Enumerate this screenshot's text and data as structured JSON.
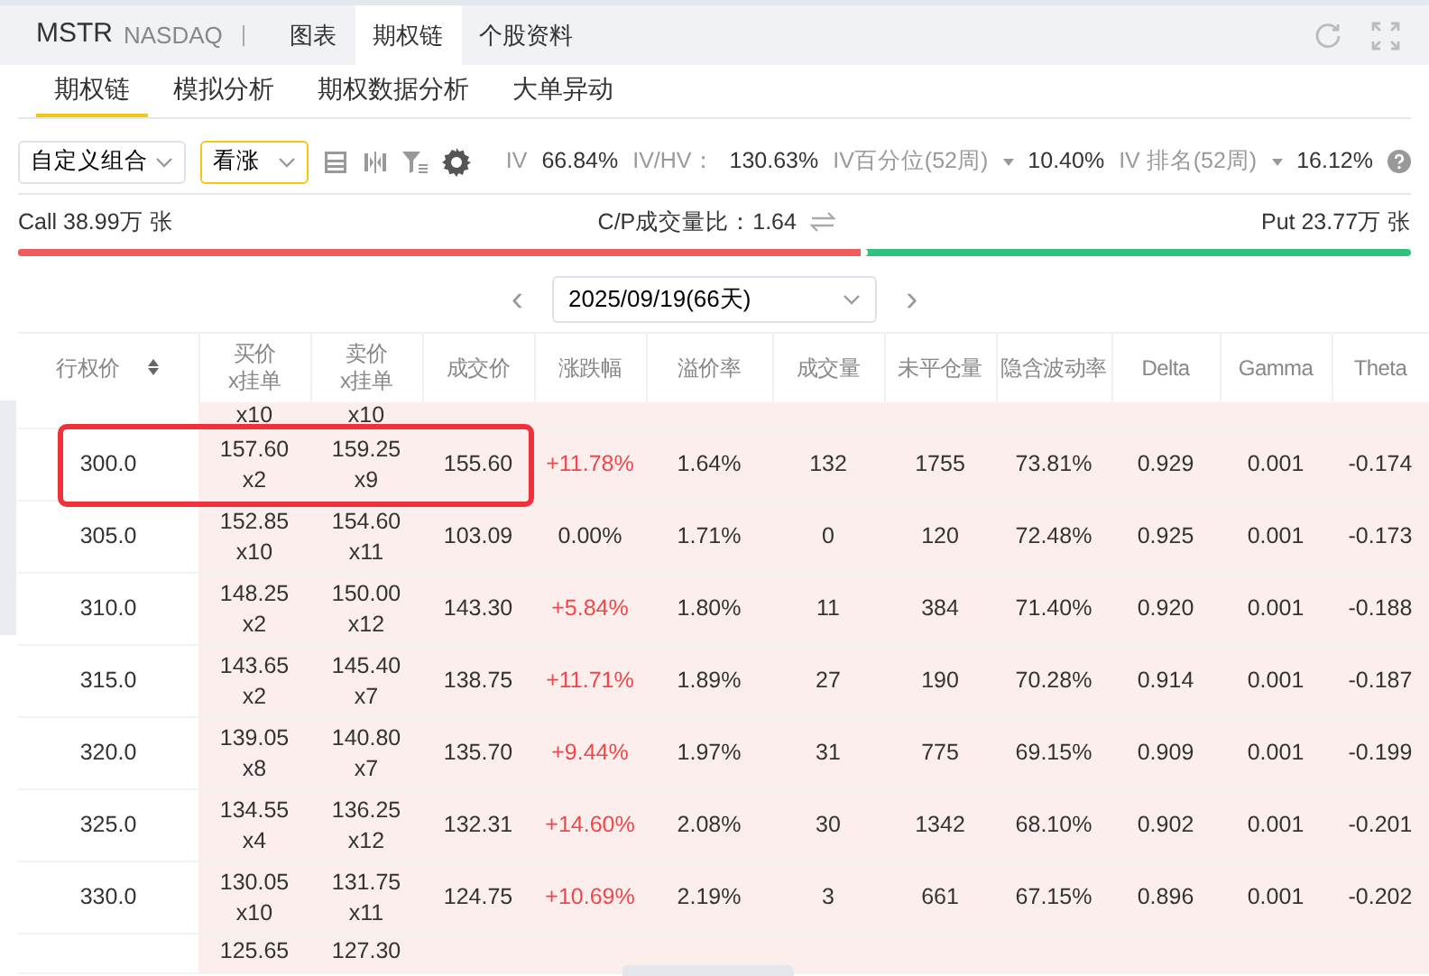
{
  "header": {
    "symbol": "MSTR",
    "exchange": "NASDAQ",
    "separator": "|",
    "tabs": [
      {
        "label": "图表",
        "selected": false
      },
      {
        "label": "期权链",
        "selected": true
      },
      {
        "label": "个股资料",
        "selected": false
      }
    ]
  },
  "subtabs": [
    {
      "label": "期权链",
      "selected": true
    },
    {
      "label": "模拟分析",
      "selected": false
    },
    {
      "label": "期权数据分析",
      "selected": false
    },
    {
      "label": "大单异动",
      "selected": false
    }
  ],
  "toolbar": {
    "strategy": "自定义组合",
    "direction": "看涨",
    "stats": [
      {
        "label": "IV",
        "value": "66.84%",
        "dropdown": false
      },
      {
        "label": "IV/HV：",
        "value": "130.63%",
        "dropdown": false
      },
      {
        "label": "IV百分位(52周)",
        "value": "10.40%",
        "dropdown": true
      },
      {
        "label": "IV 排名(52周)",
        "value": "16.12%",
        "dropdown": true
      }
    ]
  },
  "volume_ratio": {
    "call": "Call 38.99万 张",
    "ratio_label": "C/P成交量比：",
    "ratio": "1.64",
    "put": "Put 23.77万 张",
    "level": 0.61
  },
  "expiry": {
    "prev": "‹",
    "date": "2025/09/19(66天)",
    "next": "›"
  },
  "table": {
    "columns": [
      "行权价",
      "买价\nx挂单",
      "卖价\nx挂单",
      "成交价",
      "涨跌幅",
      "溢价率",
      "成交量",
      "未平仓量",
      "隐含波动率",
      "Delta",
      "Gamma",
      "Theta"
    ],
    "partial_top": {
      "bid_size": "x10",
      "ask_size": "x10"
    },
    "rows": [
      {
        "strike": "300.0",
        "bid": "157.60",
        "bid_size": "x2",
        "ask": "159.25",
        "ask_size": "x9",
        "last": "155.60",
        "change": "+11.78%",
        "rising": true,
        "premium": "1.64%",
        "volume": "132",
        "open_interest": "1755",
        "iv": "73.81%",
        "delta": "0.929",
        "gamma": "0.001",
        "theta": "-0.174",
        "highlighted": true
      },
      {
        "strike": "305.0",
        "bid": "152.85",
        "bid_size": "x10",
        "ask": "154.60",
        "ask_size": "x11",
        "last": "103.09",
        "change": "0.00%",
        "rising": false,
        "premium": "1.71%",
        "volume": "0",
        "open_interest": "120",
        "iv": "72.48%",
        "delta": "0.925",
        "gamma": "0.001",
        "theta": "-0.173",
        "highlighted": false
      },
      {
        "strike": "310.0",
        "bid": "148.25",
        "bid_size": "x2",
        "ask": "150.00",
        "ask_size": "x12",
        "last": "143.30",
        "change": "+5.84%",
        "rising": true,
        "premium": "1.80%",
        "volume": "11",
        "open_interest": "384",
        "iv": "71.40%",
        "delta": "0.920",
        "gamma": "0.001",
        "theta": "-0.188",
        "highlighted": false
      },
      {
        "strike": "315.0",
        "bid": "143.65",
        "bid_size": "x2",
        "ask": "145.40",
        "ask_size": "x7",
        "last": "138.75",
        "change": "+11.71%",
        "rising": true,
        "premium": "1.89%",
        "volume": "27",
        "open_interest": "190",
        "iv": "70.28%",
        "delta": "0.914",
        "gamma": "0.001",
        "theta": "-0.187",
        "highlighted": false
      },
      {
        "strike": "320.0",
        "bid": "139.05",
        "bid_size": "x8",
        "ask": "140.80",
        "ask_size": "x7",
        "last": "135.70",
        "change": "+9.44%",
        "rising": true,
        "premium": "1.97%",
        "volume": "31",
        "open_interest": "775",
        "iv": "69.15%",
        "delta": "0.909",
        "gamma": "0.001",
        "theta": "-0.199",
        "highlighted": false
      },
      {
        "strike": "325.0",
        "bid": "134.55",
        "bid_size": "x4",
        "ask": "136.25",
        "ask_size": "x12",
        "last": "132.31",
        "change": "+14.60%",
        "rising": true,
        "premium": "2.08%",
        "volume": "30",
        "open_interest": "1342",
        "iv": "68.10%",
        "delta": "0.902",
        "gamma": "0.001",
        "theta": "-0.201",
        "highlighted": false
      },
      {
        "strike": "330.0",
        "bid": "130.05",
        "bid_size": "x10",
        "ask": "131.75",
        "ask_size": "x11",
        "last": "124.75",
        "change": "+10.69%",
        "rising": true,
        "premium": "2.19%",
        "volume": "3",
        "open_interest": "661",
        "iv": "67.15%",
        "delta": "0.896",
        "gamma": "0.001",
        "theta": "-0.202",
        "highlighted": false
      }
    ],
    "partial_bottom": {
      "bid": "125.65",
      "ask": "127.30"
    }
  }
}
